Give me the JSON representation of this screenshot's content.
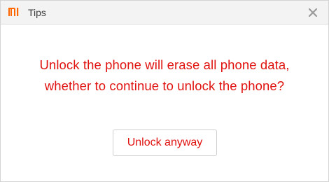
{
  "window": {
    "title": "Tips",
    "logo_icon": "mi-logo-icon",
    "close_icon": "close-icon"
  },
  "dialog": {
    "message": "Unlock the phone will erase all phone data, whether to continue to unlock the phone?",
    "action_label": "Unlock anyway"
  },
  "colors": {
    "brand": "#ff6700",
    "message_text": "#e0120f",
    "titlebar_bg": "#f3f3f3",
    "close_icon": "#9a9a9a"
  }
}
